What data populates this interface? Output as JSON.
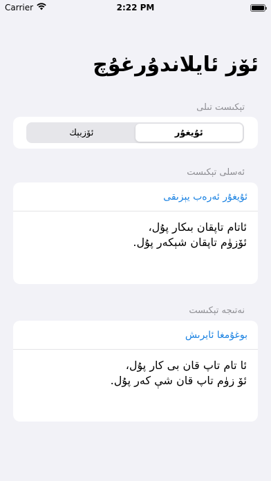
{
  "status_bar": {
    "carrier": "Carrier",
    "time": "2:22 PM"
  },
  "page_title": "ئۆز ئايلاندۇرغۇچ",
  "language_section": {
    "header": "تېكىست تىلى",
    "options": [
      {
        "label": "ئۇيغۇر",
        "selected": true
      },
      {
        "label": "ئۆزبېك",
        "selected": false
      }
    ]
  },
  "source_section": {
    "header": "ئەسلى تېكىست",
    "link_label": "ئۇيغۇر ئەرەب يېزىقى",
    "lines": [
      "ئاتام تاپقان بىكار پۇل،",
      "ئۆزۈم تاپقان شېكەر پۇل."
    ]
  },
  "result_section": {
    "header": "نەتىجە تېكىست",
    "link_label": "بوغۇمغا ئايرىش",
    "lines": [
      "ئا تام تاپ قان بى كار پۇل،",
      "ئۆ زۈم تاپ قان شې كەر پۇل."
    ]
  }
}
